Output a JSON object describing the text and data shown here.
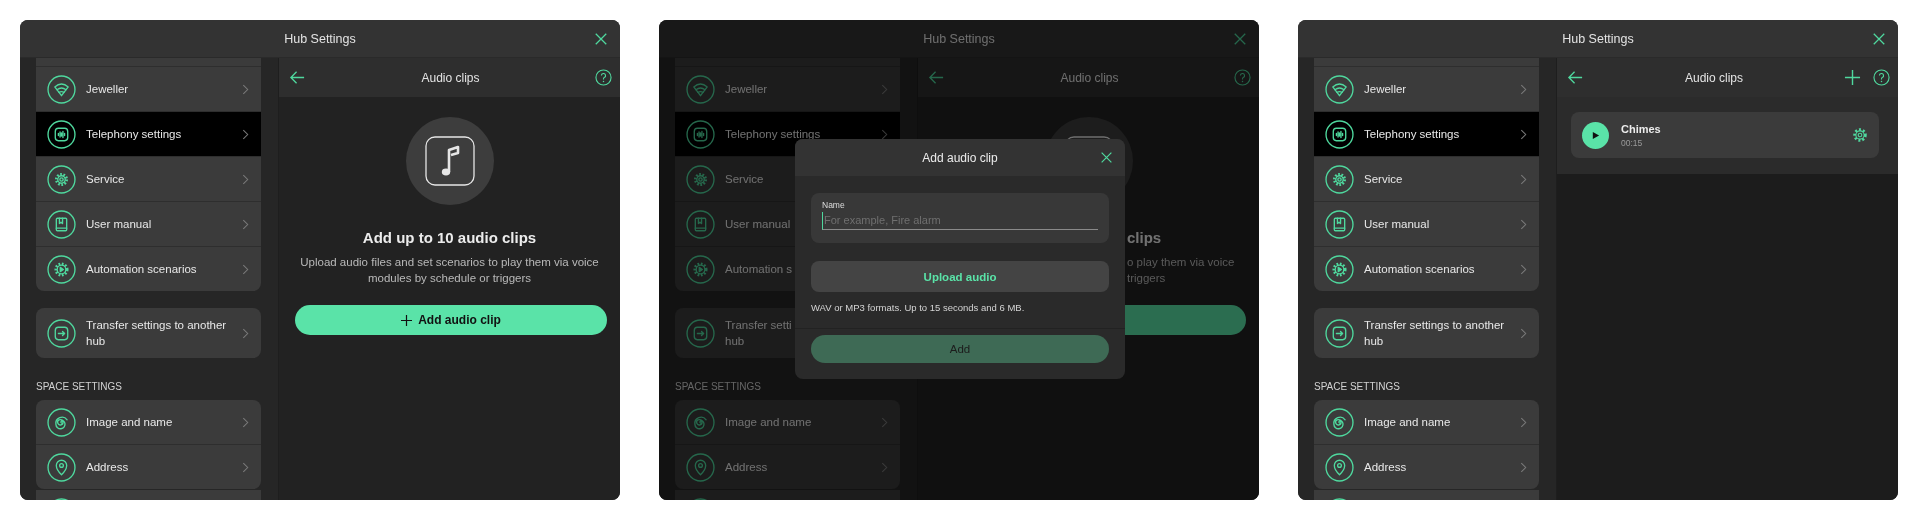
{
  "screens": [
    {
      "window": {
        "title": "Hub Settings"
      },
      "sidebar": {
        "groups": [
          {
            "items": [
              {
                "label": "Jeweller",
                "selected": false
              },
              {
                "label": "Telephony settings",
                "selected": true
              },
              {
                "label": "Service",
                "selected": false
              },
              {
                "label": "User manual",
                "selected": false
              },
              {
                "label": "Automation scenarios",
                "selected": false
              }
            ]
          },
          {
            "items": [
              {
                "label": "Transfer settings to another hub",
                "selected": false
              }
            ]
          },
          {
            "heading": "SPACE SETTINGS",
            "items": [
              {
                "label": "Image and name",
                "selected": false
              },
              {
                "label": "Address",
                "selected": false
              }
            ]
          }
        ]
      },
      "pane": {
        "title": "Audio clips",
        "add_action": false,
        "kind": "empty",
        "empty_state": {
          "heading": "Add up to 10 audio clips",
          "description": "Upload audio files and set scenarios to play them via voice modules by schedule or triggers",
          "button": "Add audio clip"
        }
      }
    },
    {
      "window": {
        "title": "Hub Settings"
      },
      "sidebar": {
        "groups": [
          {
            "items": [
              {
                "label": "Jeweller",
                "selected": false
              },
              {
                "label": "Telephony settings",
                "selected": true
              },
              {
                "label": "Service",
                "selected": false
              },
              {
                "label": "User manual",
                "selected": false
              },
              {
                "label": "Automation s",
                "selected": false
              }
            ]
          },
          {
            "items": [
              {
                "label": "Transfer setti\nhub",
                "selected": false
              }
            ]
          },
          {
            "heading": "SPACE SETTINGS",
            "items": [
              {
                "label": "Image and name",
                "selected": false
              },
              {
                "label": "Address",
                "selected": false
              }
            ]
          }
        ]
      },
      "pane": {
        "title": "Audio clips",
        "add_action": false,
        "kind": "empty",
        "empty_state": {
          "heading": "clips",
          "description": "o play them via voice triggers"
        }
      },
      "modal": {
        "title": "Add audio clip",
        "field": {
          "label": "Name",
          "placeholder": "For example, Fire alarm"
        },
        "upload_button": "Upload audio",
        "hint": "WAV or MP3 formats. Up to 15 seconds and 6 MB.",
        "submit": {
          "label": "Add",
          "disabled": true
        }
      }
    },
    {
      "window": {
        "title": "Hub Settings"
      },
      "sidebar": {
        "groups": [
          {
            "items": [
              {
                "label": "Jeweller",
                "selected": false
              },
              {
                "label": "Telephony settings",
                "selected": true
              },
              {
                "label": "Service",
                "selected": false
              },
              {
                "label": "User manual",
                "selected": false
              },
              {
                "label": "Automation scenarios",
                "selected": false
              }
            ]
          },
          {
            "items": [
              {
                "label": "Transfer settings to another hub",
                "selected": false
              }
            ]
          },
          {
            "heading": "SPACE SETTINGS",
            "items": [
              {
                "label": "Image and name",
                "selected": false
              },
              {
                "label": "Address",
                "selected": false
              }
            ]
          }
        ]
      },
      "pane": {
        "title": "Audio clips",
        "add_action": true,
        "kind": "list",
        "clips": [
          {
            "name": "Chimes",
            "duration": "00:15"
          }
        ]
      }
    }
  ]
}
